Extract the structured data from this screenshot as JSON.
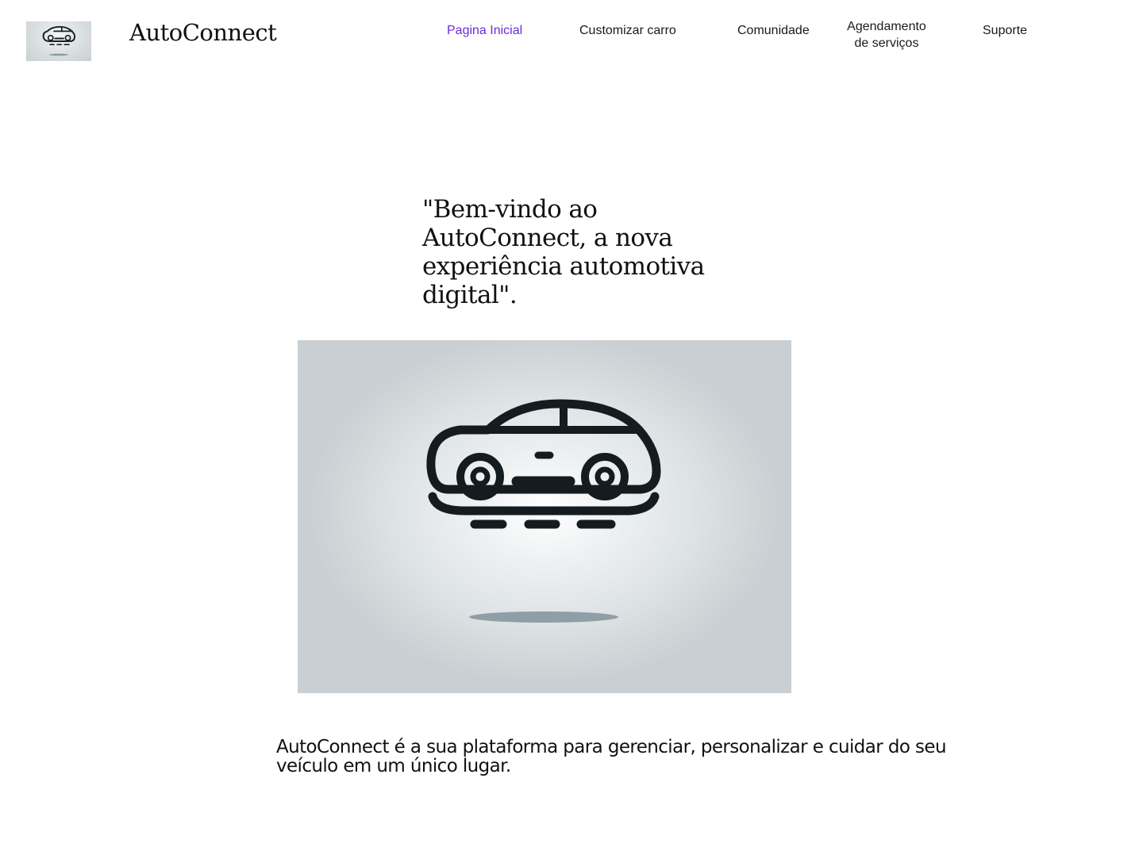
{
  "header": {
    "logo_icon": "car-icon",
    "brand_name": "AutoConnect"
  },
  "nav": {
    "active_color": "#6b2bd9",
    "items": [
      {
        "label": "Pagina Inicial",
        "active": true
      },
      {
        "label": "Customizar carro",
        "active": false
      },
      {
        "label": "Comunidade",
        "active": false
      },
      {
        "label_line1": "Agendamento",
        "label_line2": "de serviços",
        "active": false
      },
      {
        "label": "Suporte",
        "active": false
      }
    ]
  },
  "hero": {
    "title": "\"Bem-vindo ao AutoConnect, a nova experiência automotiva digital\".",
    "image_icon": "car-icon",
    "description": "AutoConnect é a sua plataforma para gerenciar, personalizar e cuidar do seu veículo em um único lugar."
  }
}
